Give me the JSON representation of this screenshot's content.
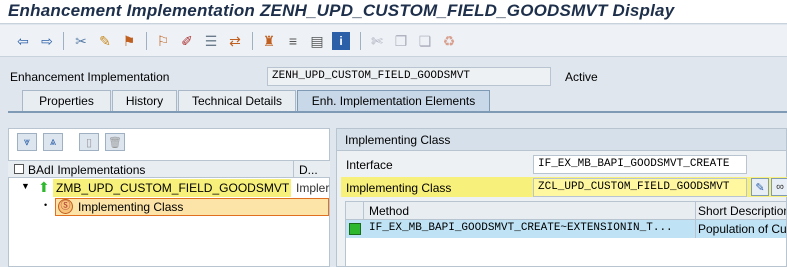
{
  "window": {
    "title": "Enhancement Implementation ZENH_UPD_CUSTOM_FIELD_GOODSMVT Display"
  },
  "toolbar": {
    "icons": [
      "arrow-left-icon",
      "arrow-right-icon",
      "other-object-icon",
      "display-change-icon",
      "activate-icon",
      "where-used-icon",
      "edit-icon",
      "object-list-icon",
      "navigate-icon",
      "hierarchy-icon",
      "layout-icon",
      "info-icon",
      "cut-icon",
      "copy-icon",
      "paste-icon",
      "undo-icon"
    ]
  },
  "header": {
    "label": "Enhancement Implementation",
    "value": "ZENH_UPD_CUSTOM_FIELD_GOODSMVT",
    "status": "Active"
  },
  "tabs": [
    {
      "label": "Properties"
    },
    {
      "label": "History"
    },
    {
      "label": "Technical Details"
    },
    {
      "label": "Enh. Implementation Elements",
      "active": true
    }
  ],
  "left": {
    "col1": "BAdI Implementations",
    "col2": "D...",
    "rows": [
      {
        "label": "ZMB_UPD_CUSTOM_FIELD_GOODSMVT",
        "extra": "Impler"
      },
      {
        "label": "Implementing Class"
      }
    ]
  },
  "right": {
    "title": "Implementing Class",
    "interface_label": "Interface",
    "interface_value": "IF_EX_MB_BAPI_GOODSMVT_CREATE",
    "impl_label": "Implementing Class",
    "impl_value": "ZCL_UPD_CUSTOM_FIELD_GOODSMVT",
    "table": {
      "col_method": "Method",
      "col_desc": "Short Description",
      "rows": [
        {
          "method": "IF_EX_MB_BAPI_GOODSMVT_CREATE~EXTENSIONIN_T...",
          "desc": "Population of Cu"
        }
      ]
    }
  },
  "colors": {
    "highlight": "#f7f07a",
    "status_green": "#2eb82e"
  }
}
